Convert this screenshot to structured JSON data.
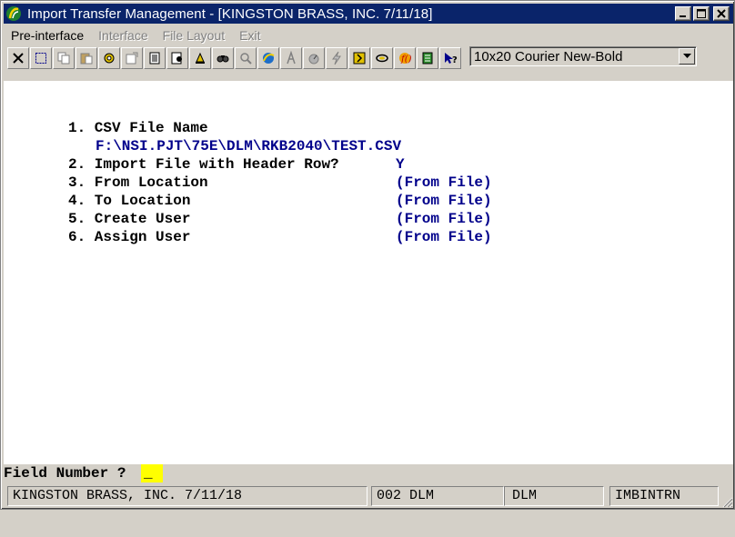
{
  "window": {
    "title": "Import Transfer Management - [KINGSTON BRASS, INC. 7/11/18]",
    "minimize": "_",
    "maximize": "□",
    "close": "×"
  },
  "menu": [
    {
      "label": "Pre-interface",
      "enabled": true
    },
    {
      "label": "Interface",
      "enabled": false
    },
    {
      "label": "File Layout",
      "enabled": false
    },
    {
      "label": "Exit",
      "enabled": false
    }
  ],
  "toolbar": {
    "font_value": "10x20 Courier New-Bold",
    "icons": [
      "close-icon",
      "select-icon",
      "copy-icon",
      "paste-icon",
      "settings-gear-icon",
      "properties-icon",
      "document-icon",
      "print-preview-icon",
      "bell-icon",
      "find-icon",
      "zoom-icon",
      "web-globe-icon",
      "font-icon",
      "gauge-icon",
      "lightning-icon",
      "user-icon",
      "link-icon",
      "function-icon",
      "notes-icon",
      "help-pointer-icon"
    ]
  },
  "form": {
    "item1_label": "1. CSV File Name",
    "item1_value": "F:\\NSI.PJT\\75E\\DLM\\RKB2040\\TEST.CSV",
    "item2_label": "2. Import File with Header Row?",
    "item2_value": "Y",
    "item3_label": "3. From Location",
    "item3_value": "(From File)",
    "item4_label": "4. To Location",
    "item4_value": "(From File)",
    "item5_label": "5. Create User",
    "item5_value": "(From File)",
    "item6_label": "6. Assign User",
    "item6_value": "(From File)"
  },
  "prompt": {
    "label": "Field Number ?",
    "input_value": "_"
  },
  "status": {
    "company": "KINGSTON BRASS, INC. 7/11/18",
    "session": "002 DLM",
    "user": "DLM",
    "program": "IMBINTRN"
  }
}
